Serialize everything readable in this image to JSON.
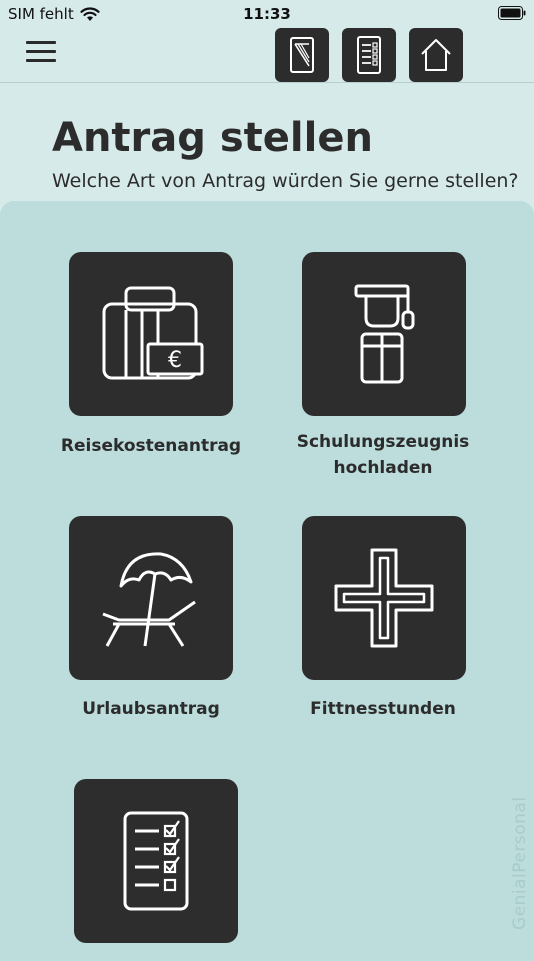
{
  "status_bar": {
    "carrier": "SIM fehlt",
    "time": "11:33"
  },
  "nav": {
    "menu_icon": "hamburger-menu-icon",
    "buttons": [
      {
        "icon": "document-icon"
      },
      {
        "icon": "checklist-icon"
      },
      {
        "icon": "home-icon"
      }
    ]
  },
  "header": {
    "title": "Antrag stellen",
    "subtitle": "Welche Art von Antrag würden Sie gerne stellen?"
  },
  "tiles": [
    {
      "label": "Reisekostenantrag",
      "icon": "travel-expense-icon"
    },
    {
      "label": "Schulungszeugnis\nhochladen",
      "icon": "graduate-icon"
    },
    {
      "label": "Urlaubsantrag",
      "icon": "beach-chair-icon"
    },
    {
      "label": "Fittnesstunden",
      "icon": "fitness-cross-icon"
    },
    {
      "label": "",
      "icon": "checklist-icon"
    }
  ],
  "watermark": "GenialPersonal",
  "colors": {
    "background": "#d6eaea",
    "panel": "#bddcdc",
    "tile": "#2d2d2d",
    "text": "#2c2c2c"
  }
}
